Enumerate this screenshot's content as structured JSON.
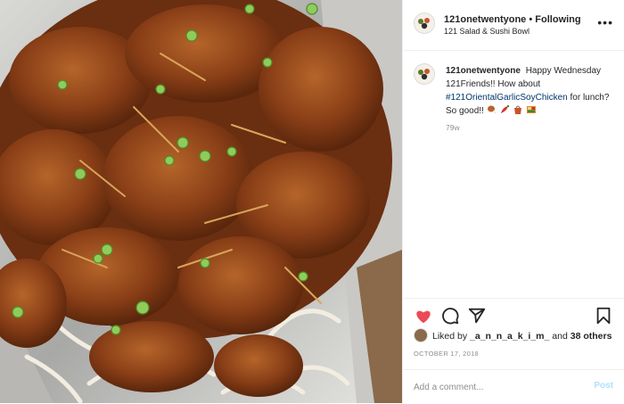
{
  "header": {
    "username": "121onetwentyone",
    "separator": "•",
    "follow_status": "Following",
    "location": "121 Salad & Sushi Bowl"
  },
  "caption": {
    "username": "121onetwentyone",
    "text_before": "Happy Wednesday 121Friends!! How about",
    "hashtag": "#121OrientalGarlicSoyChicken",
    "text_after": "for lunch? So good!!",
    "emojis": [
      "drumstick",
      "chili-pepper",
      "takeout-box",
      "bento-box"
    ],
    "time_ago": "79w"
  },
  "actions": {
    "icons": [
      "heart-icon",
      "comment-icon",
      "share-icon",
      "bookmark-icon"
    ],
    "heart_color": "#ed4956"
  },
  "likes": {
    "prefix": "Liked by",
    "user": "_a_n_n_a_k_i_m_",
    "middle": "and",
    "others": "38 others"
  },
  "date": "OCTOBER 17, 2018",
  "comment": {
    "placeholder": "Add a comment...",
    "post_label": "Post"
  },
  "photo": {
    "subject": "fried garlic soy chicken with green onions on bean sprouts in foil tray"
  }
}
